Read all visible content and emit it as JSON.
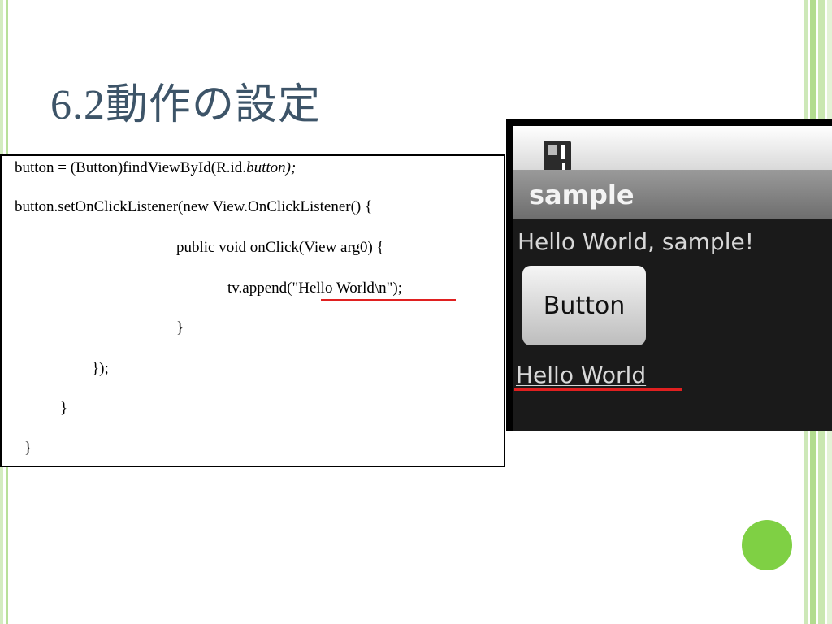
{
  "slide": {
    "title": "6.2動作の設定"
  },
  "code": {
    "line1_prefix": "button = (Button)findViewById(R.id.",
    "line1_italic": "button);",
    "line2": "button.setOnClickListener(new View.OnClickListener() {",
    "line3": "public void onClick(View arg0) {",
    "line4": "tv.append(\"Hello World\\n\");",
    "line5": "}",
    "line6": "});",
    "line7": "}",
    "line8": "}"
  },
  "emulator": {
    "app_title": "sample",
    "hello_text": "Hello World, sample!",
    "button_label": "Button",
    "appended_text": "Hello World"
  },
  "colors": {
    "title": "#3d5468",
    "highlight_underline": "#e02020",
    "accent_dot": "#7fd044",
    "border_stripe": "#b2dc8e"
  }
}
